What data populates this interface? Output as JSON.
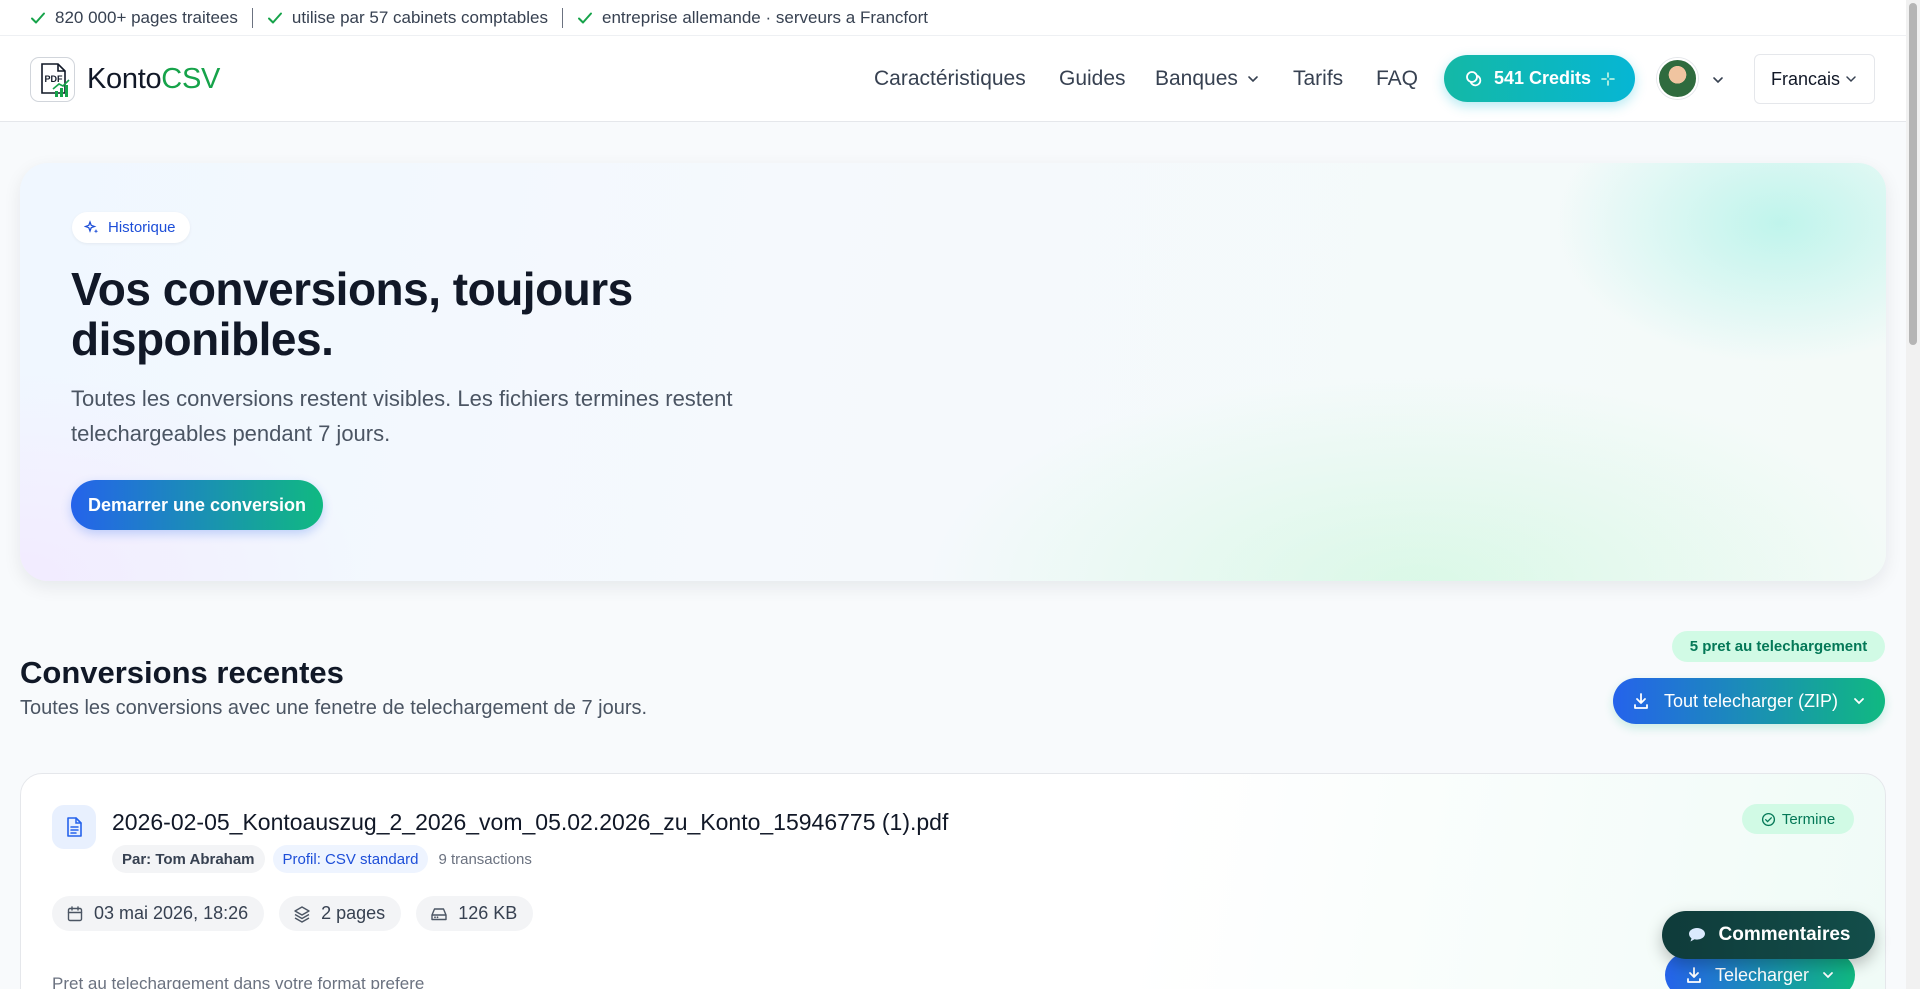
{
  "trustbar": {
    "items": [
      "820 000+ pages traitees",
      "utilise par 57 cabinets comptables",
      "entreprise allemande · serveurs a Francfort"
    ]
  },
  "header": {
    "logo": {
      "name_part1": "Konto",
      "name_part2": "CSV",
      "icon_text": "PDF"
    },
    "nav": {
      "features": "Caractéristiques",
      "guides": "Guides",
      "banks": "Banques",
      "pricing": "Tarifs",
      "faq": "FAQ"
    },
    "credits_label": "541 Credits",
    "language": "Francais"
  },
  "hero": {
    "badge": "Historique",
    "title_line1": "Vos conversions, toujours",
    "title_line2": "disponibles.",
    "subtitle": "Toutes les conversions restent visibles. Les fichiers termines restent telechargeables pendant 7 jours.",
    "cta": "Demarrer une conversion"
  },
  "recent": {
    "title": "Conversions recentes",
    "subtitle": "Toutes les conversions avec une fenetre de telechargement de 7 jours.",
    "ready_badge": "5 pret au telechargement",
    "zip_button": "Tout telecharger (ZIP)",
    "items": [
      {
        "file_name": "2026-02-05_Kontoauszug_2_2026_vom_05.02.2026_zu_Konto_15946775 (1).pdf",
        "user": "Par: Tom Abraham",
        "profile": "Profil: CSV standard",
        "transactions": "9 transactions",
        "status": "Termine",
        "date": "03 mai 2026, 18:26",
        "pages": "2 pages",
        "size": "126 KB",
        "note": "Pret au telechargement dans votre format prefere",
        "download": "Telecharger"
      }
    ]
  },
  "feedback": {
    "label": "Commentaires"
  },
  "colors": {
    "brand_green": "#16a34a",
    "accent_blue": "#2563eb",
    "accent_teal": "#10b981",
    "credits_teal": "#14b8a6"
  }
}
